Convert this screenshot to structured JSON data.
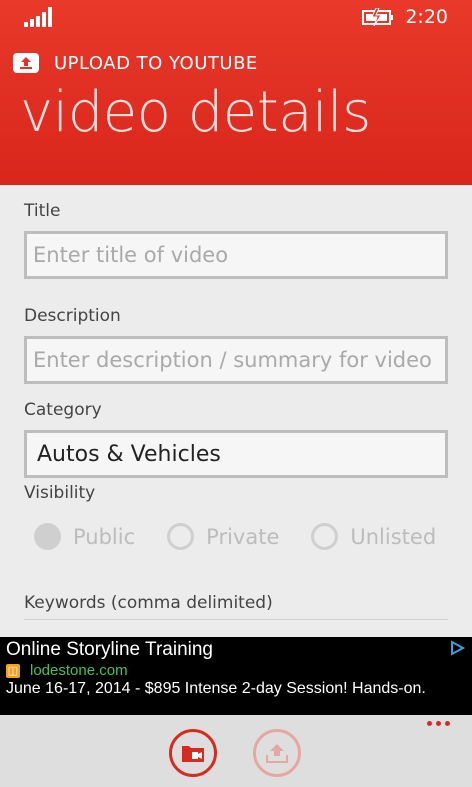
{
  "status": {
    "time": "2:20"
  },
  "header": {
    "app_title": "UPLOAD TO YOUTUBE",
    "page_title": "video details"
  },
  "form": {
    "title_label": "Title",
    "title_placeholder": "Enter title of video",
    "title_value": "",
    "description_label": "Description",
    "description_placeholder": "Enter description / summary for video",
    "description_value": "",
    "category_label": "Category",
    "category_value": "Autos & Vehicles",
    "visibility_label": "Visibility",
    "visibility_options": [
      {
        "label": "Public",
        "selected": true
      },
      {
        "label": "Private",
        "selected": false
      },
      {
        "label": "Unlisted",
        "selected": false
      }
    ],
    "keywords_label": "Keywords (comma delimited)"
  },
  "ad": {
    "headline": "Online Storyline Training",
    "url": "lodestone.com",
    "text": "June 16-17, 2014 - $895 Intense 2-day Session! Hands-on."
  },
  "app_bar": {
    "buttons": [
      "folder-video-icon",
      "upload-icon"
    ],
    "more_icon": "ellipsis-icon"
  },
  "colors": {
    "accent": "#d52b20",
    "header_bg": "#e33325",
    "ad_url": "#3fc35b"
  }
}
